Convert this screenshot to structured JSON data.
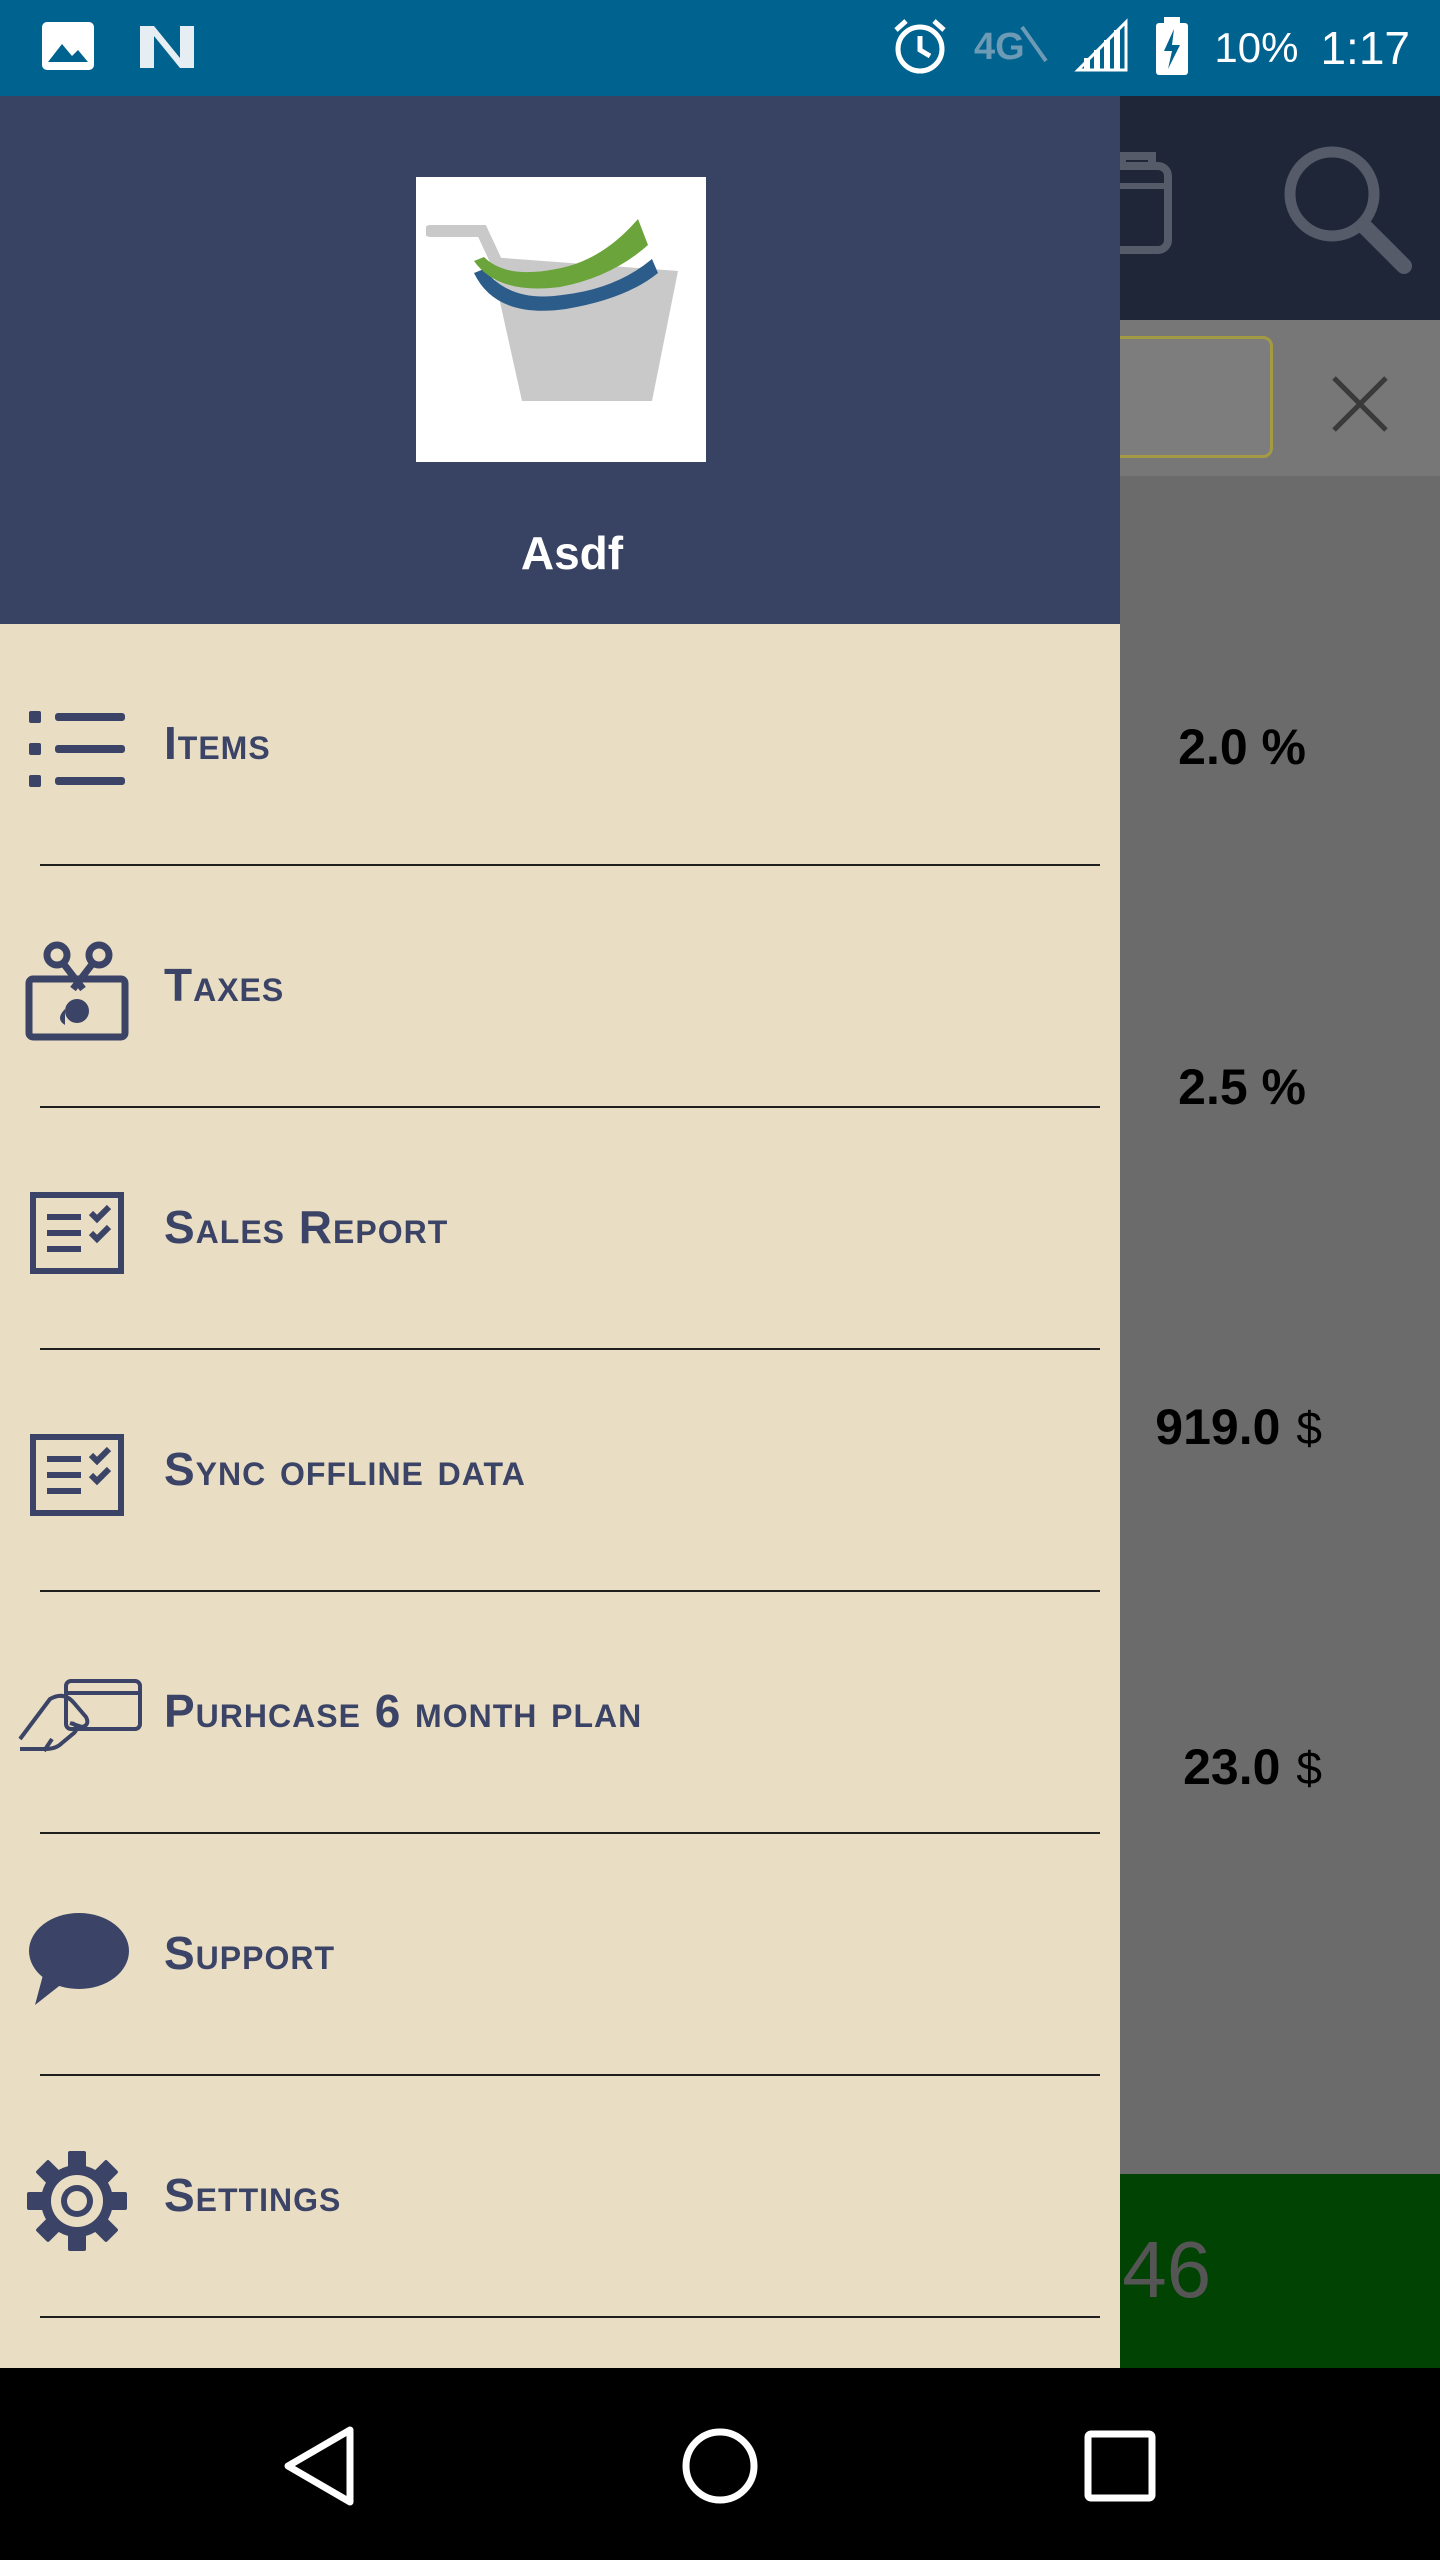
{
  "status_bar": {
    "battery": "10%",
    "time": "1:17",
    "icons": [
      "image-icon",
      "notification-n-icon",
      "alarm-icon",
      "network-4g-icon",
      "signal-icon",
      "battery-charging-icon"
    ]
  },
  "background": {
    "values": [
      {
        "amount": "2.0 %",
        "unit": ""
      },
      {
        "amount": "2.5 %",
        "unit": ""
      },
      {
        "amount": "919.0",
        "unit": "$"
      },
      {
        "amount": "23.0",
        "unit": "$"
      }
    ],
    "total_fragment": ".46"
  },
  "drawer": {
    "user_name": "Asdf",
    "items": [
      {
        "label": "Items",
        "icon": "list-icon"
      },
      {
        "label": "Taxes",
        "icon": "tax-icon"
      },
      {
        "label": "Sales Report",
        "icon": "report-icon"
      },
      {
        "label": "Sync offline data",
        "icon": "sync-report-icon"
      },
      {
        "label": "Purhcase 6 month plan",
        "icon": "card-payment-icon"
      },
      {
        "label": "Support",
        "icon": "chat-bubble-icon"
      },
      {
        "label": "Settings",
        "icon": "gear-icon"
      }
    ]
  },
  "colors": {
    "status_bar": "#00628f",
    "drawer_header": "#384364",
    "drawer_bg": "#e9ddc3",
    "menu_text": "#3b4466",
    "total_bar": "#014303"
  }
}
